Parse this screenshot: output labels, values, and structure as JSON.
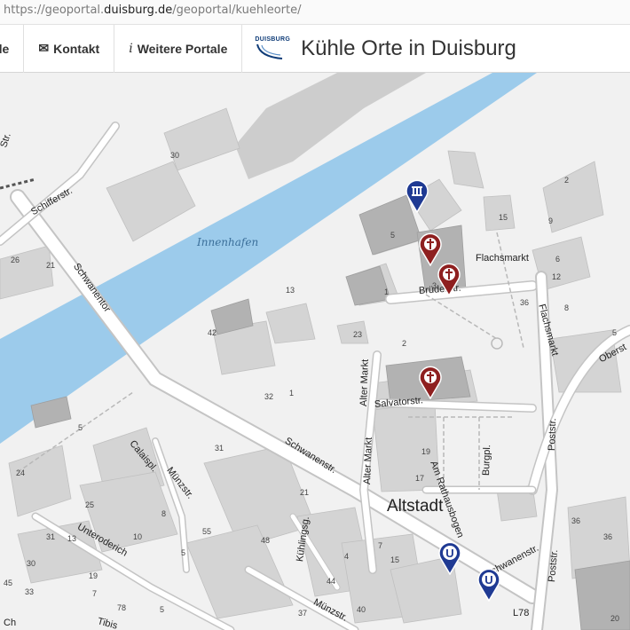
{
  "browser": {
    "url_prefix": "https://geoportal.",
    "url_host": "duisburg.de",
    "url_path": "/geoportal/kuehleorte/"
  },
  "header": {
    "nav_partial": "de",
    "nav_contact": "Kontakt",
    "nav_more_portals": "Weitere Portale",
    "logo_text": "DUISBURG",
    "title": "Kühle Orte in Duisburg"
  },
  "map": {
    "water_label": "Innenhafen",
    "district_label": "Altstadt",
    "streets": {
      "schifferstr": "Schifferstr.",
      "str_top": "Str.",
      "schwanentor": "Schwanentor",
      "schwanenstr": "Schwanenstr.",
      "schwanenstr2": "Schwanenstr.",
      "flachsmarkt": "Flachsmarkt",
      "flachsmarkt_v": "Flachsmarkt",
      "bruederstr": "Brüderstr.",
      "salvatorstr": "Salvatorstr.",
      "alter_markt_1": "Alter Markt",
      "alter_markt_2": "Alter Markt",
      "am_rathausbogen": "Am Rathausbogen",
      "burgpl": "Burgpl.",
      "poststr_1": "Poststr.",
      "poststr_2": "Poststr.",
      "oberstr": "Oberst",
      "calaispl": "Calaispl.",
      "muenzstr_1": "Münzstr.",
      "muenzstr_2": "Münzstr.",
      "unteroderich": "Unteroderich",
      "kuehlingsg": "Kühlingsg.",
      "tibis": "Tibis",
      "l78": "L78",
      "ch": "Ch"
    },
    "house_numbers": [
      "30",
      "5",
      "15",
      "2",
      "9",
      "1",
      "3",
      "13",
      "36",
      "23",
      "2",
      "8",
      "5",
      "12",
      "6",
      "26",
      "21",
      "42",
      "32",
      "1",
      "5",
      "31",
      "21",
      "19",
      "17",
      "48",
      "25",
      "8",
      "10",
      "24",
      "55",
      "15",
      "7",
      "5",
      "4",
      "40",
      "44",
      "36",
      "31",
      "13",
      "30",
      "45",
      "33",
      "20",
      "37",
      "36",
      "78",
      "5",
      "7",
      "19"
    ],
    "markers": [
      {
        "type": "museum",
        "icon": "museum-icon",
        "color": "#1f3a93"
      },
      {
        "type": "church",
        "icon": "church-icon",
        "color": "#8e1f1f"
      },
      {
        "type": "church",
        "icon": "church-icon",
        "color": "#8e1f1f"
      },
      {
        "type": "church",
        "icon": "church-icon",
        "color": "#8e1f1f"
      },
      {
        "type": "subway",
        "icon": "u-bahn-icon",
        "color": "#1f3a93"
      },
      {
        "type": "subway",
        "icon": "u-bahn-icon",
        "color": "#1f3a93"
      }
    ],
    "colors": {
      "water": "#9ccbeb",
      "building": "#d4d4d4",
      "building_dark": "#b2b2b2",
      "road": "#ffffff",
      "ground": "#f1f1f1"
    }
  }
}
